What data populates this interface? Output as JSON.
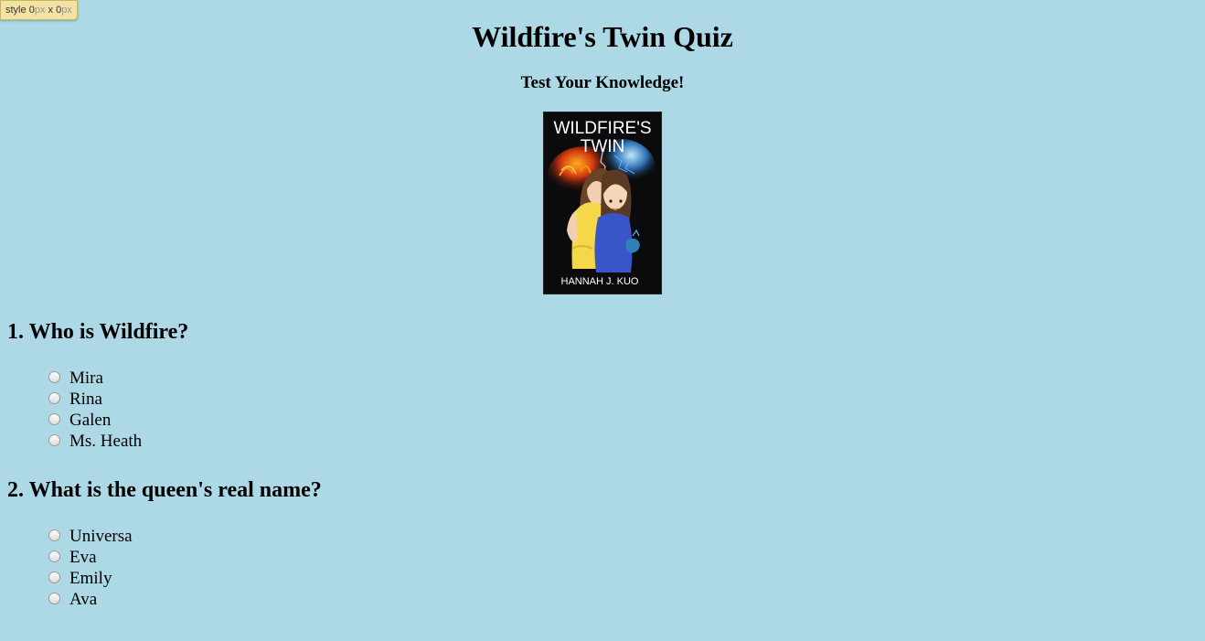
{
  "badge": {
    "label": "style",
    "width_value": "0",
    "width_unit": "px",
    "separator": "x",
    "height_value": "0",
    "height_unit": "px"
  },
  "page": {
    "title": "Wildfire's Twin Quiz",
    "subtitle": "Test Your Knowledge!",
    "background_color": "#add8e6"
  },
  "cover": {
    "title_line1": "WILDFIRE'S",
    "title_line2": "TWIN",
    "author": "HANNAH J. KUO"
  },
  "questions": [
    {
      "text": "1. Who is Wildfire?",
      "options": [
        "Mira",
        "Rina",
        "Galen",
        "Ms. Heath"
      ]
    },
    {
      "text": "2. What is the queen's real name?",
      "options": [
        "Universa",
        "Eva",
        "Emily",
        "Ava"
      ]
    }
  ]
}
